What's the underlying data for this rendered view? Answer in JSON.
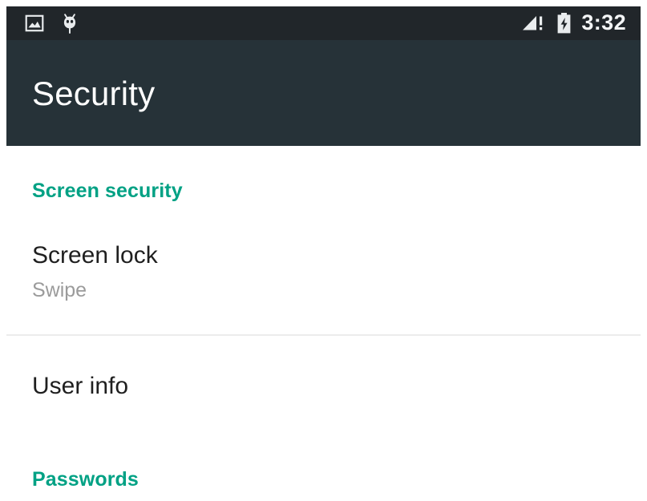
{
  "status_bar": {
    "background_color": "#21262a",
    "left_icons": [
      {
        "name": "photo-icon",
        "label": "Screenshot captured"
      },
      {
        "name": "bug-icon",
        "label": "USB debugging connected"
      }
    ],
    "right_icons": [
      {
        "name": "signal-warning-icon",
        "label": "No service"
      },
      {
        "name": "battery-charging-icon",
        "label": "Charging"
      }
    ],
    "clock": "3:32"
  },
  "app_bar": {
    "title": "Security",
    "background_color": "#263238",
    "title_color": "#ffffff"
  },
  "accent_color": "#00a184",
  "content": {
    "sections": [
      {
        "header": "Screen security",
        "items": [
          {
            "title": "Screen lock",
            "subtitle": "Swipe"
          },
          {
            "title": "User info",
            "subtitle": ""
          }
        ]
      },
      {
        "header": "Passwords",
        "items": []
      }
    ]
  }
}
